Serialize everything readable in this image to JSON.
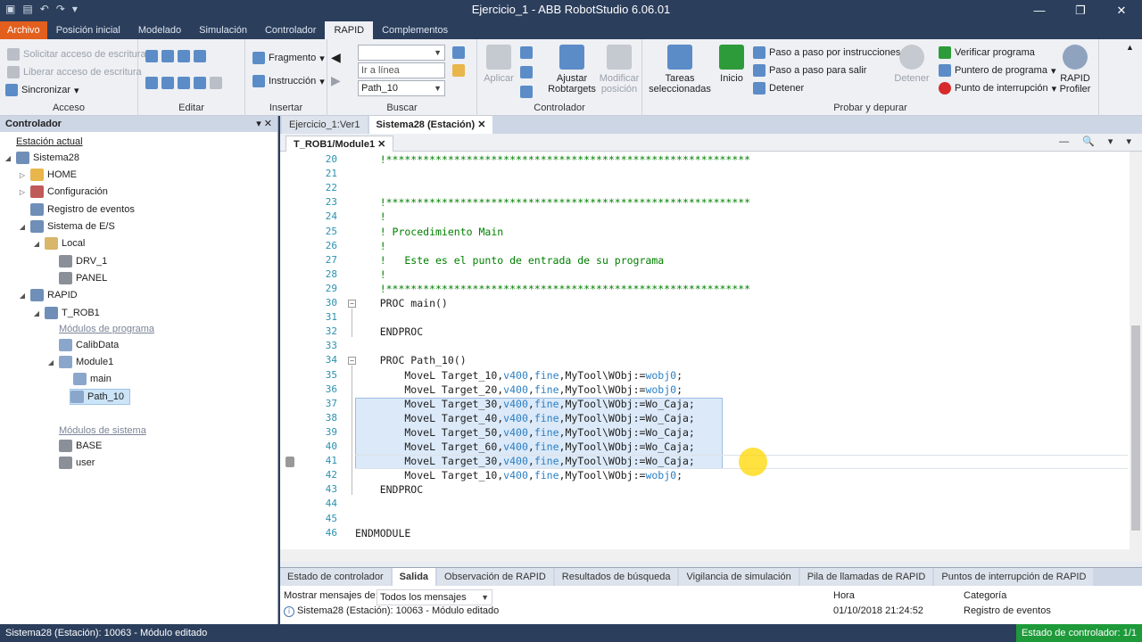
{
  "window": {
    "title": "Ejercicio_1 - ABB RobotStudio 6.06.01"
  },
  "ribbon_tabs": [
    "Archivo",
    "Posición inicial",
    "Modelado",
    "Simulación",
    "Controlador",
    "RAPID",
    "Complementos"
  ],
  "ribbon": {
    "acceso": {
      "label": "Acceso",
      "solicitar": "Solicitar acceso de escritura",
      "liberar": "Liberar acceso de escritura",
      "sincronizar": "Sincronizar"
    },
    "editar": {
      "label": "Editar"
    },
    "insertar": {
      "label": "Insertar",
      "fragmento": "Fragmento",
      "instruccion": "Instrucción"
    },
    "buscar": {
      "label": "Buscar",
      "combo1": "",
      "ir_a_linea": "Ir a línea",
      "path": "Path_10"
    },
    "controlador": {
      "label": "Controlador",
      "aplicar": "Aplicar",
      "ajustar": "Ajustar\nRobtargets",
      "modificar": "Modificar\nposición"
    },
    "probar": {
      "label": "Probar y depurar",
      "tareas": "Tareas\nseleccionadas",
      "inicio": "Inicio",
      "paso_instr": "Paso a paso por instrucciones",
      "paso_salir": "Paso a paso para salir",
      "detener": "Detener",
      "detener2": "Detener",
      "verificar": "Verificar programa",
      "puntero": "Puntero de programa",
      "interrupcion": "Punto de interrupción",
      "profiler": "RAPID\nProfiler"
    }
  },
  "controller_panel": {
    "title": "Controlador",
    "estacion_actual": "Estación actual",
    "nodes": {
      "sistema": "Sistema28",
      "home": "HOME",
      "config": "Configuración",
      "registro": "Registro de eventos",
      "es": "Sistema de E/S",
      "local": "Local",
      "drv": "DRV_1",
      "panel": "PANEL",
      "rapid": "RAPID",
      "trob": "T_ROB1",
      "modprog": "Módulos de programa",
      "calib": "CalibData",
      "module1": "Module1",
      "main": "main",
      "path10": "Path_10",
      "modsis": "Módulos de sistema",
      "base": "BASE",
      "user": "user"
    }
  },
  "doc_tabs": [
    "Ejercicio_1:Ver1",
    "Sistema28 (Estación)"
  ],
  "editor_tab": "T_ROB1/Module1",
  "code": [
    {
      "n": "20",
      "t": "    !***********************************************************",
      "c": "cm"
    },
    {
      "n": "21",
      "t": "",
      "c": ""
    },
    {
      "n": "22",
      "t": "",
      "c": ""
    },
    {
      "n": "23",
      "t": "    !***********************************************************",
      "c": "cm"
    },
    {
      "n": "24",
      "t": "    !",
      "c": "cm"
    },
    {
      "n": "25",
      "t": "    ! Procedimiento Main",
      "c": "cm"
    },
    {
      "n": "26",
      "t": "    !",
      "c": "cm"
    },
    {
      "n": "27",
      "t": "    !   Este es el punto de entrada de su programa",
      "c": "cm"
    },
    {
      "n": "28",
      "t": "    !",
      "c": "cm"
    },
    {
      "n": "29",
      "t": "    !***********************************************************",
      "c": "cm"
    },
    {
      "n": "30",
      "t": "    PROC main()",
      "c": "kw"
    },
    {
      "n": "31",
      "t": "",
      "c": ""
    },
    {
      "n": "32",
      "t": "    ENDPROC",
      "c": "kw"
    },
    {
      "n": "33",
      "t": "",
      "c": ""
    },
    {
      "n": "34",
      "t": "    PROC Path_10()",
      "c": "kw"
    },
    {
      "n": "35",
      "t": "        MoveL Target_10,v400,fine,MyTool\\WObj:=wobj0;",
      "c": "mv"
    },
    {
      "n": "36",
      "t": "        MoveL Target_20,v400,fine,MyTool\\WObj:=wobj0;",
      "c": "mv"
    },
    {
      "n": "37",
      "t": "        MoveL Target_30,v400,fine,MyTool\\WObj:=Wo_Caja;",
      "c": "mv"
    },
    {
      "n": "38",
      "t": "        MoveL Target_40,v400,fine,MyTool\\WObj:=Wo_Caja;",
      "c": "mv"
    },
    {
      "n": "39",
      "t": "        MoveL Target_50,v400,fine,MyTool\\WObj:=Wo_Caja;",
      "c": "mv"
    },
    {
      "n": "40",
      "t": "        MoveL Target_60,v400,fine,MyTool\\WObj:=Wo_Caja;",
      "c": "mv"
    },
    {
      "n": "41",
      "t": "        MoveL Target_30,v400,fine,MyTool\\WObj:=Wo_Caja;",
      "c": "mv"
    },
    {
      "n": "42",
      "t": "        MoveL Target_10,v400,fine,MyTool\\WObj:=wobj0;",
      "c": "mv"
    },
    {
      "n": "43",
      "t": "    ENDPROC",
      "c": "kw"
    },
    {
      "n": "44",
      "t": "",
      "c": ""
    },
    {
      "n": "45",
      "t": "",
      "c": ""
    },
    {
      "n": "46",
      "t": "ENDMODULE",
      "c": "kw"
    }
  ],
  "output_tabs": [
    "Estado de controlador",
    "Salida",
    "Observación de RAPID",
    "Resultados de búsqueda",
    "Vigilancia de simulación",
    "Pila de llamadas de RAPID",
    "Puntos de interrupción de RAPID"
  ],
  "output": {
    "mostrar": "Mostrar mensajes de:",
    "filtro": "Todos los mensajes",
    "hora_hdr": "Hora",
    "cat_hdr": "Categoría",
    "msg": "Sistema28 (Estación): 10063 - Módulo editado",
    "hora": "01/10/2018 21:24:52",
    "categoria": "Registro de eventos"
  },
  "status": {
    "left": "Sistema28 (Estación): 10063 - Módulo editado",
    "right": "Estado de controlador: 1/1"
  }
}
